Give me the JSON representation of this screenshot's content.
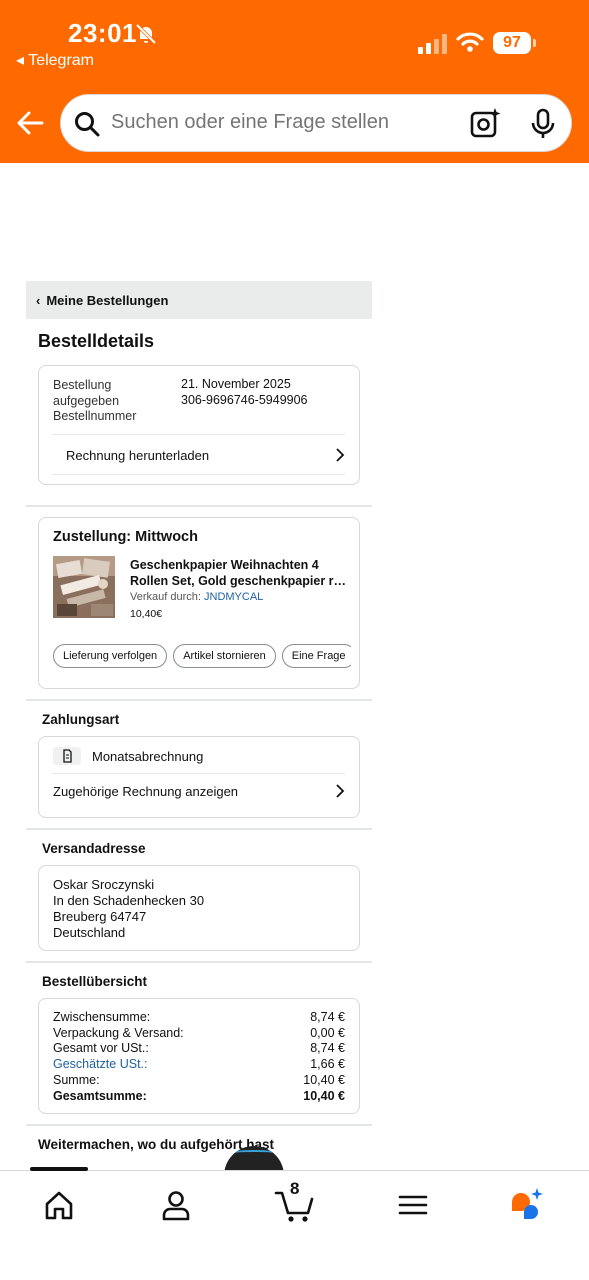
{
  "status_bar": {
    "time": "23:01",
    "back_app": "◂ Telegram",
    "battery": "97"
  },
  "search": {
    "placeholder": "Suchen oder eine Frage stellen"
  },
  "breadcrumb": {
    "label": "Meine Bestellungen"
  },
  "page": {
    "title": "Bestelldetails"
  },
  "order": {
    "rows": [
      {
        "label": "Bestellung aufgegeben",
        "value": "21. November 2025"
      },
      {
        "label": "Bestellnummer",
        "value": "306-9696746-5949906"
      }
    ],
    "invoice_label": "Rechnung herunterladen"
  },
  "shipment": {
    "title": "Zustellung: Mittwoch",
    "product_name": "Geschenkpapier Weihnachten 4 Rollen Set, Gold geschenkpapier r…",
    "seller_prefix": "Verkauf durch: ",
    "seller": "JNDMYCAL",
    "price": "10,40€",
    "actions": [
      "Lieferung verfolgen",
      "Artikel stornieren",
      "Eine Frage"
    ]
  },
  "payment": {
    "title": "Zahlungsart",
    "method": "Monatsabrechnung",
    "invoice_link": "Zugehörige Rechnung anzeigen"
  },
  "address": {
    "title": "Versandadresse",
    "lines": [
      "Oskar Sroczynski",
      "In den Schadenhecken 30",
      "Breuberg 64747",
      "Deutschland"
    ]
  },
  "summary": {
    "title": "Bestellübersicht",
    "rows": [
      {
        "label": "Zwischensumme:",
        "value": "8,74 €"
      },
      {
        "label": "Verpackung & Versand:",
        "value": "0,00 €"
      },
      {
        "label": "Gesamt vor USt.:",
        "value": "8,74 €"
      },
      {
        "label": "Geschätzte USt.:",
        "value": "1,66 €"
      },
      {
        "label": "Summe:",
        "value": "10,40 €"
      },
      {
        "label": "Gesamtsumme:",
        "value": "10,40 €"
      }
    ]
  },
  "continue": {
    "title": "Weitermachen, wo du aufgehört hast"
  },
  "tabbar": {
    "cart_count": "8"
  },
  "colors": {
    "brand": "#ff6a00",
    "link": "#2162a1",
    "rufus_orange": "#ff6a00",
    "rufus_blue": "#1a73e8"
  }
}
